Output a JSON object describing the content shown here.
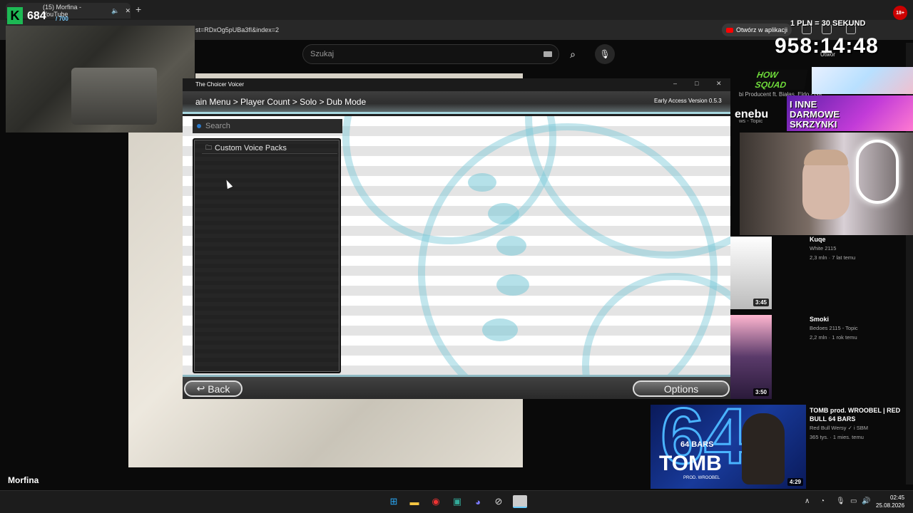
{
  "browser": {
    "tab_title": "(15) Morfina - YouTube",
    "url": "st=RDxOg5pUBa3fI&index=2",
    "open_in_app": "Otwórz w aplikacji"
  },
  "stream_overlay": {
    "viewers": "684",
    "viewer_cap": "/ 700",
    "timer_rate": "1 PLN = 30 SEKUND",
    "timer": "958:14:48",
    "sponsor_a": "HOW SQUAD",
    "sponsor_b": "enebu",
    "promo_text": "I INNE DARMOWE SKRZYNKI",
    "partial_label": "Utwór"
  },
  "youtube": {
    "search_placeholder": "Szukaj",
    "channel_name": "Morfina",
    "partial_top_item": "bi Producent ft. Białas, Eldo - Ga",
    "partial_topic": "ws - Topic",
    "sidebar": [
      {
        "title": "Kuqe",
        "channel": "White 2115",
        "meta": "2,3 mln · 7 lat temu",
        "duration": "3:45"
      },
      {
        "title": "Smoki",
        "channel": "Bedoes 2115 - Topic",
        "meta": "2,2 mln · 1 rok temu",
        "duration": "3:50"
      },
      {
        "title": "TOMB prod. WROOBEL | RED BULL 64 BARS",
        "channel": "Red Bull Wersy",
        "channel2": "i SBM",
        "meta": "365 tys. · 1 mies. temu",
        "duration": "4:29"
      }
    ],
    "thumb_text_64": "64",
    "thumb_text_bars": "64 BARS",
    "thumb_text_tomb": "TOMB",
    "thumb_text_prod": "PROD. WROOBEL"
  },
  "game": {
    "window_title": "The Choicer Voicer",
    "breadcrumb": "ain Menu > Player Count > Solo > Dub Mode",
    "version": "Early Access Version 0.5.3",
    "search_placeholder": "Search",
    "pack_item": "Custom Voice Packs",
    "back_button": "Back",
    "options_button": "Options"
  },
  "taskbar": {
    "time": "02:45",
    "date": "25.08.2026"
  },
  "colors": {
    "accent_light_blue": "#a8d8e0",
    "youtube_red": "#ff0000",
    "sponsor_green": "#6fdc3a"
  }
}
